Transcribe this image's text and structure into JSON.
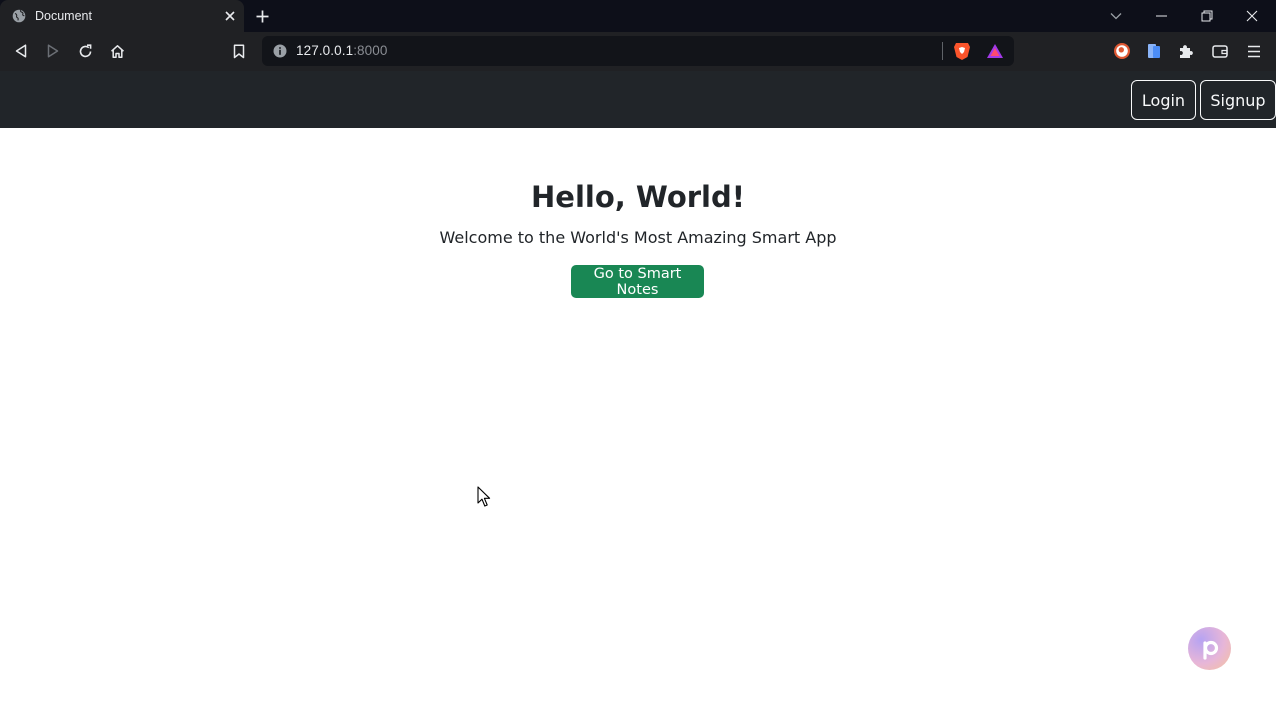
{
  "browser": {
    "tab_title": "Document",
    "url_host": "127.0.0.1",
    "url_port": ":8000"
  },
  "icons": {
    "tab_favicon": "globe-icon",
    "tab_close": "close-icon",
    "new_tab": "plus-icon",
    "back": "back-arrow-icon",
    "forward": "forward-arrow-icon",
    "reload": "reload-icon",
    "home": "home-icon",
    "bookmark": "bookmark-icon",
    "site_info": "info-icon",
    "brave_shields": "brave-lion-icon",
    "brave_rewards": "triangle-icon",
    "duckduckgo": "duck-icon",
    "reading_list": "reader-icon",
    "extensions": "puzzle-icon",
    "wallet": "wallet-icon",
    "menu": "hamburger-icon",
    "tab_search": "chevron-down-icon",
    "minimize": "minimize-icon",
    "restore": "restore-icon",
    "close_window": "close-icon",
    "floating_badge": "p-logo-icon",
    "cursor": "mouse-cursor-icon"
  },
  "colors": {
    "navbar_bg": "#212529",
    "cta_bg": "#198754",
    "text": "#212529"
  },
  "navbar": {
    "login_label": "Login",
    "signup_label": "Signup"
  },
  "hero": {
    "title": "Hello, World!",
    "subtitle": "Welcome to the World's Most Amazing Smart App",
    "cta_label": "Go to Smart Notes"
  }
}
